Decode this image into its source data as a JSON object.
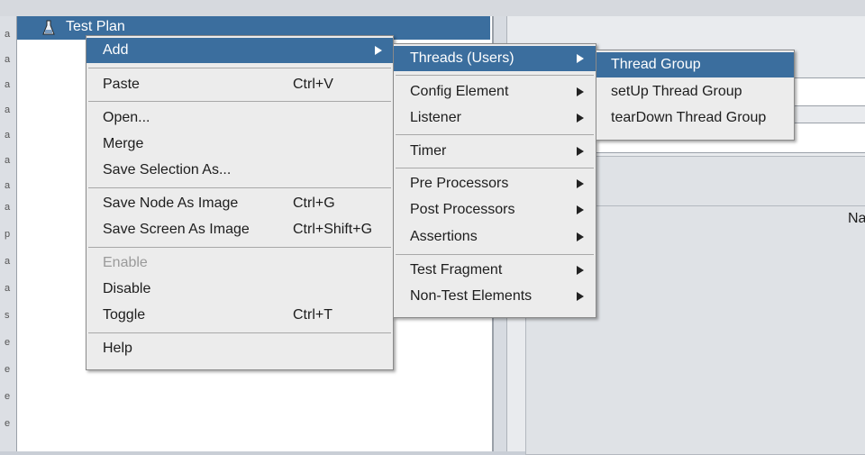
{
  "tree": {
    "root_label": "Test Plan"
  },
  "right_panel": {
    "name_label": "Na"
  },
  "gutter_chars": [
    "a",
    "a",
    "a",
    "a",
    "a",
    "a",
    "a",
    "a",
    "p",
    "a",
    "a",
    "s",
    "e",
    "e",
    "e",
    "e"
  ],
  "context_menu": {
    "items": [
      {
        "label": "Add",
        "shortcut": ""
      },
      {
        "label": "Paste",
        "shortcut": "Ctrl+V"
      },
      {
        "label": "Open...",
        "shortcut": ""
      },
      {
        "label": "Merge",
        "shortcut": ""
      },
      {
        "label": "Save Selection As...",
        "shortcut": ""
      },
      {
        "label": "Save Node As Image",
        "shortcut": "Ctrl+G"
      },
      {
        "label": "Save Screen As Image",
        "shortcut": "Ctrl+Shift+G"
      },
      {
        "label": "Enable",
        "shortcut": ""
      },
      {
        "label": "Disable",
        "shortcut": ""
      },
      {
        "label": "Toggle",
        "shortcut": "Ctrl+T"
      },
      {
        "label": "Help",
        "shortcut": ""
      }
    ]
  },
  "add_submenu": {
    "items": [
      {
        "label": "Threads (Users)"
      },
      {
        "label": "Config Element"
      },
      {
        "label": "Listener"
      },
      {
        "label": "Timer"
      },
      {
        "label": "Pre Processors"
      },
      {
        "label": "Post Processors"
      },
      {
        "label": "Assertions"
      },
      {
        "label": "Test Fragment"
      },
      {
        "label": "Non-Test Elements"
      }
    ]
  },
  "threads_submenu": {
    "items": [
      {
        "label": "Thread Group"
      },
      {
        "label": "setUp Thread Group"
      },
      {
        "label": "tearDown Thread Group"
      }
    ]
  },
  "colors": {
    "selection": "#3b6e9e",
    "menu_bg": "#ececec",
    "disabled": "#9a9a9a"
  }
}
